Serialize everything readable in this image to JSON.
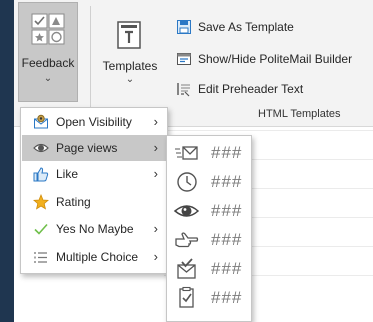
{
  "ribbon": {
    "feedback": {
      "label": "Feedback",
      "chevron": "⌄"
    },
    "templates": {
      "label": "Templates",
      "chevron": "⌄"
    },
    "buttons": [
      {
        "label": "Save As Template",
        "icon": "save-template-icon"
      },
      {
        "label": "Show/Hide PoliteMail Builder",
        "icon": "builder-icon"
      },
      {
        "label": "Edit Preheader Text",
        "icon": "preheader-icon"
      }
    ],
    "group_label": "HTML Templates"
  },
  "menu": {
    "items": [
      {
        "label": "Open Visibility",
        "icon": "open-visibility-icon",
        "has_submenu": true
      },
      {
        "label": "Page views",
        "icon": "eye-icon",
        "has_submenu": true,
        "active": true
      },
      {
        "label": "Like",
        "icon": "thumbs-up-icon",
        "has_submenu": true
      },
      {
        "label": "Rating",
        "icon": "star-icon",
        "has_submenu": false
      },
      {
        "label": "Yes No Maybe",
        "icon": "checkmark-icon",
        "has_submenu": true
      },
      {
        "label": "Multiple Choice",
        "icon": "list-icon",
        "has_submenu": true
      }
    ],
    "arrow": "›"
  },
  "submenu": {
    "items": [
      {
        "icon": "envelope-icon",
        "label": "###"
      },
      {
        "icon": "clock-icon",
        "label": "###"
      },
      {
        "icon": "eye-icon",
        "label": "###"
      },
      {
        "icon": "pointing-hand-icon",
        "label": "###"
      },
      {
        "icon": "envelope-check-icon",
        "label": "###"
      },
      {
        "icon": "clipboard-check-icon",
        "label": "###"
      }
    ]
  },
  "colors": {
    "background": "#1f3650",
    "ribbon": "#f3f3f3",
    "pressed": "#c8c8c8",
    "accent_blue": "#2b78c5",
    "star": "#f2b01e",
    "check_green": "#6fbf4a"
  }
}
